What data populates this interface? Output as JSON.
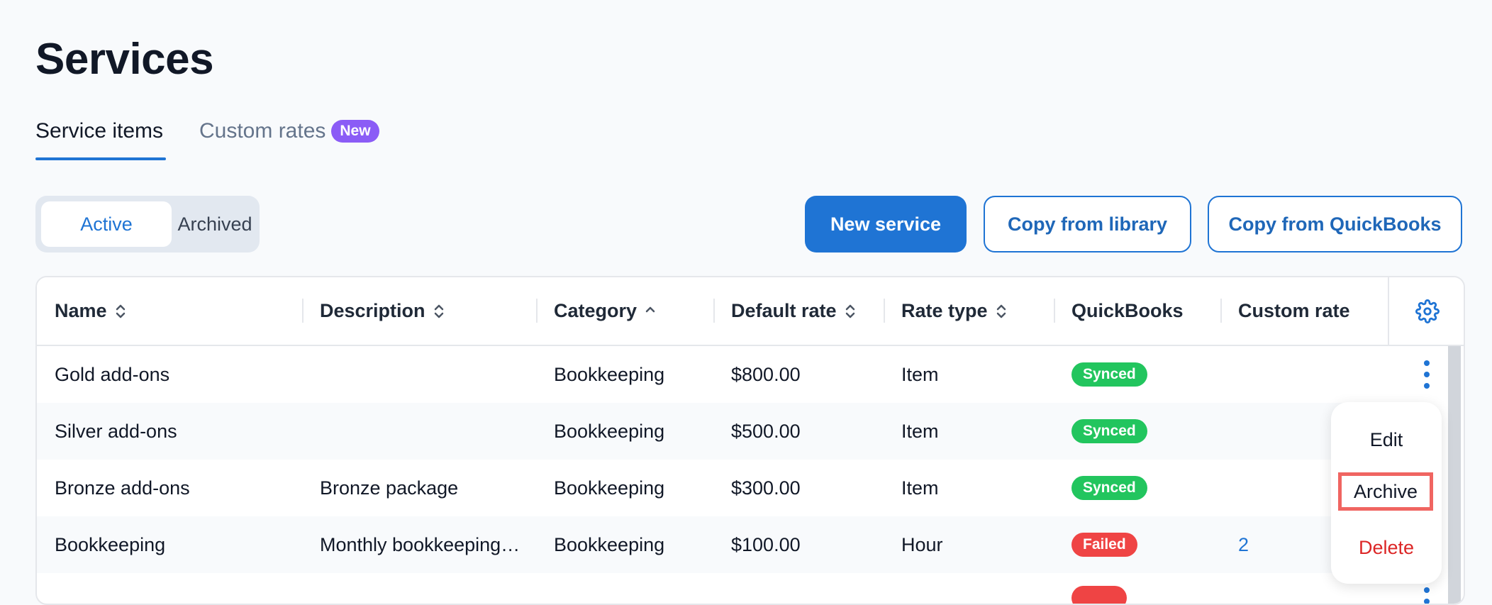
{
  "page": {
    "title": "Services"
  },
  "tabs": [
    {
      "label": "Service items",
      "active": true
    },
    {
      "label": "Custom rates",
      "badge": "New",
      "active": false
    }
  ],
  "filter": {
    "options": [
      "Active",
      "Archived"
    ],
    "selected": "Active"
  },
  "actions": {
    "new_service": "New service",
    "copy_library": "Copy from library",
    "copy_quickbooks": "Copy from QuickBooks"
  },
  "table": {
    "columns": [
      "Name",
      "Description",
      "Category",
      "Default rate",
      "Rate type",
      "QuickBooks",
      "Custom rate"
    ],
    "sort": {
      "column": "Category",
      "direction": "ascending"
    },
    "rows": [
      {
        "name": "Gold add-ons",
        "description": "",
        "category": "Bookkeeping",
        "default_rate": "$800.00",
        "rate_type": "Item",
        "quickbooks": "Synced",
        "custom_rate": ""
      },
      {
        "name": "Silver add-ons",
        "description": "",
        "category": "Bookkeeping",
        "default_rate": "$500.00",
        "rate_type": "Item",
        "quickbooks": "Synced",
        "custom_rate": ""
      },
      {
        "name": "Bronze add-ons",
        "description": "Bronze package",
        "category": "Bookkeeping",
        "default_rate": "$300.00",
        "rate_type": "Item",
        "quickbooks": "Synced",
        "custom_rate": ""
      },
      {
        "name": "Bookkeeping",
        "description": "Monthly bookkeeping…",
        "category": "Bookkeeping",
        "default_rate": "$100.00",
        "rate_type": "Hour",
        "quickbooks": "Failed",
        "custom_rate": "2"
      }
    ]
  },
  "row_menu": {
    "items": [
      "Edit",
      "Archive",
      "Delete"
    ],
    "highlighted": "Archive"
  },
  "colors": {
    "accent": "#1f74d4",
    "badge_new": "#8b5cf6",
    "synced": "#22c55e",
    "failed": "#ef4444",
    "delete": "#dc2626",
    "highlight_box": "#f06561"
  },
  "icons": {
    "sort": "sort-icon",
    "settings": "gear-icon",
    "row_actions": "kebab-menu-icon"
  }
}
